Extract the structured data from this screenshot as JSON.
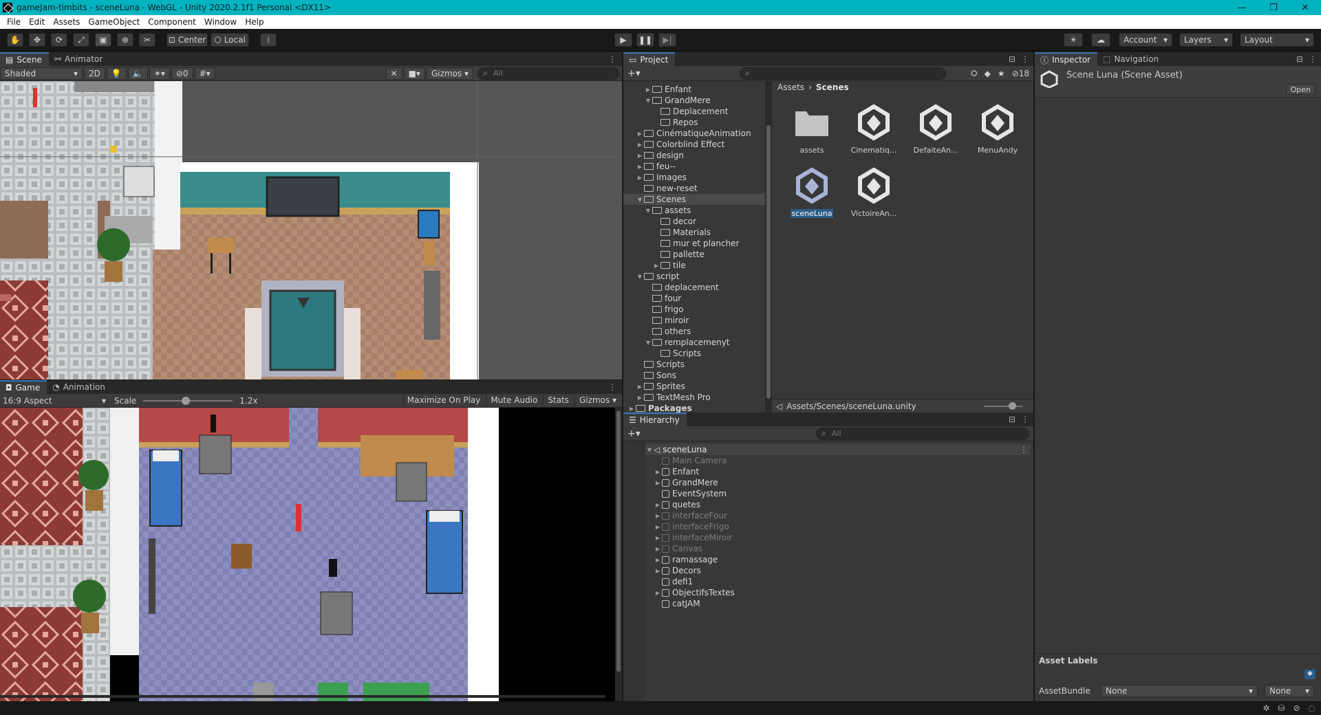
{
  "window": {
    "title": "gameJam-timbits - sceneLuna - WebGL - Unity 2020.2.1f1 Personal <DX11>",
    "controls": [
      "—",
      "❐",
      "✕"
    ]
  },
  "menu": [
    "File",
    "Edit",
    "Assets",
    "GameObject",
    "Component",
    "Window",
    "Help"
  ],
  "toolbar": {
    "pivot": "Center",
    "space": "Local",
    "account": "Account",
    "layers": "Layers",
    "layout": "Layout"
  },
  "scene": {
    "tabs": [
      "Scene",
      "Animator"
    ],
    "shading": "Shaded",
    "mode2d": "2D",
    "hidden_count": "0",
    "gizmos": "Gizmos",
    "search_placeholder": "All"
  },
  "game": {
    "tabs": [
      "Game",
      "Animation"
    ],
    "aspect": "16:9 Aspect",
    "scale_label": "Scale",
    "scale_value": "1.2x",
    "maximize": "Maximize On Play",
    "mute": "Mute Audio",
    "stats": "Stats",
    "gizmos": "Gizmos"
  },
  "project": {
    "tab": "Project",
    "hidden_count": "18",
    "breadcrumb": [
      "Assets",
      "Scenes"
    ],
    "path": "Assets/Scenes/sceneLuna.unity",
    "tree": [
      {
        "label": "Enfant",
        "depth": 2,
        "arrow": "right"
      },
      {
        "label": "GrandMere",
        "depth": 2,
        "arrow": "down"
      },
      {
        "label": "Deplacement",
        "depth": 3,
        "arrow": ""
      },
      {
        "label": "Repos",
        "depth": 3,
        "arrow": ""
      },
      {
        "label": "CinématiqueAnimation",
        "depth": 1,
        "arrow": "right"
      },
      {
        "label": "Colorblind Effect",
        "depth": 1,
        "arrow": "right"
      },
      {
        "label": "design",
        "depth": 1,
        "arrow": "right"
      },
      {
        "label": "feu--",
        "depth": 1,
        "arrow": "right"
      },
      {
        "label": "Images",
        "depth": 1,
        "arrow": "right"
      },
      {
        "label": "new-reset",
        "depth": 1,
        "arrow": ""
      },
      {
        "label": "Scenes",
        "depth": 1,
        "arrow": "down",
        "selected": true
      },
      {
        "label": "assets",
        "depth": 2,
        "arrow": "down"
      },
      {
        "label": "decor",
        "depth": 3,
        "arrow": ""
      },
      {
        "label": "Materials",
        "depth": 3,
        "arrow": ""
      },
      {
        "label": "mur et plancher",
        "depth": 3,
        "arrow": ""
      },
      {
        "label": "pallette",
        "depth": 3,
        "arrow": ""
      },
      {
        "label": "tile",
        "depth": 3,
        "arrow": "right"
      },
      {
        "label": "script",
        "depth": 1,
        "arrow": "down"
      },
      {
        "label": "deplacement",
        "depth": 2,
        "arrow": ""
      },
      {
        "label": "four",
        "depth": 2,
        "arrow": ""
      },
      {
        "label": "frigo",
        "depth": 2,
        "arrow": ""
      },
      {
        "label": "miroir",
        "depth": 2,
        "arrow": ""
      },
      {
        "label": "others",
        "depth": 2,
        "arrow": ""
      },
      {
        "label": "remplacemenyt",
        "depth": 2,
        "arrow": "down"
      },
      {
        "label": "Scripts",
        "depth": 3,
        "arrow": ""
      },
      {
        "label": "Scripts",
        "depth": 1,
        "arrow": ""
      },
      {
        "label": "Sons",
        "depth": 1,
        "arrow": ""
      },
      {
        "label": "Sprites",
        "depth": 1,
        "arrow": "right"
      },
      {
        "label": "TextMesh Pro",
        "depth": 1,
        "arrow": "right"
      },
      {
        "label": "Packages",
        "depth": 0,
        "arrow": "right",
        "bold": true
      }
    ],
    "assets": [
      {
        "label": "assets",
        "kind": "folder"
      },
      {
        "label": "Cinematiq...",
        "kind": "unity"
      },
      {
        "label": "DefaiteAn...",
        "kind": "unity"
      },
      {
        "label": "MenuAndy",
        "kind": "unity"
      },
      {
        "label": "sceneLuna",
        "kind": "unity",
        "selected": true
      },
      {
        "label": "VictoireAn...",
        "kind": "unity"
      }
    ]
  },
  "hierarchy": {
    "tab": "Hierarchy",
    "search_placeholder": "All",
    "scene": "sceneLuna",
    "items": [
      {
        "label": "Main Camera",
        "arrow": false,
        "dim": true
      },
      {
        "label": "Enfant",
        "arrow": true,
        "dim": false
      },
      {
        "label": "GrandMere",
        "arrow": true,
        "dim": false
      },
      {
        "label": "EventSystem",
        "arrow": false,
        "dim": false
      },
      {
        "label": "quetes",
        "arrow": true,
        "dim": false
      },
      {
        "label": "interfaceFour",
        "arrow": true,
        "dim": true
      },
      {
        "label": "interfaceFrigo",
        "arrow": true,
        "dim": true
      },
      {
        "label": "interfaceMiroir",
        "arrow": true,
        "dim": true
      },
      {
        "label": "Canvas",
        "arrow": true,
        "dim": true
      },
      {
        "label": "ramassage",
        "arrow": true,
        "dim": false
      },
      {
        "label": "Decors",
        "arrow": true,
        "dim": false
      },
      {
        "label": "defi1",
        "arrow": false,
        "dim": false
      },
      {
        "label": "ObjectifsTextes",
        "arrow": true,
        "dim": false
      },
      {
        "label": "catJAM",
        "arrow": false,
        "dim": false
      }
    ]
  },
  "inspector": {
    "tabs": [
      "Inspector",
      "Navigation"
    ],
    "title": "Scene Luna (Scene Asset)",
    "open": "Open",
    "asset_labels": "Asset Labels",
    "assetbundle_label": "AssetBundle",
    "assetbundle_value": "None",
    "variant_value": "None"
  },
  "colors": {
    "accent": "#3a79bb",
    "selection": "#2c5d87",
    "titlebar": "#00b3bf"
  }
}
